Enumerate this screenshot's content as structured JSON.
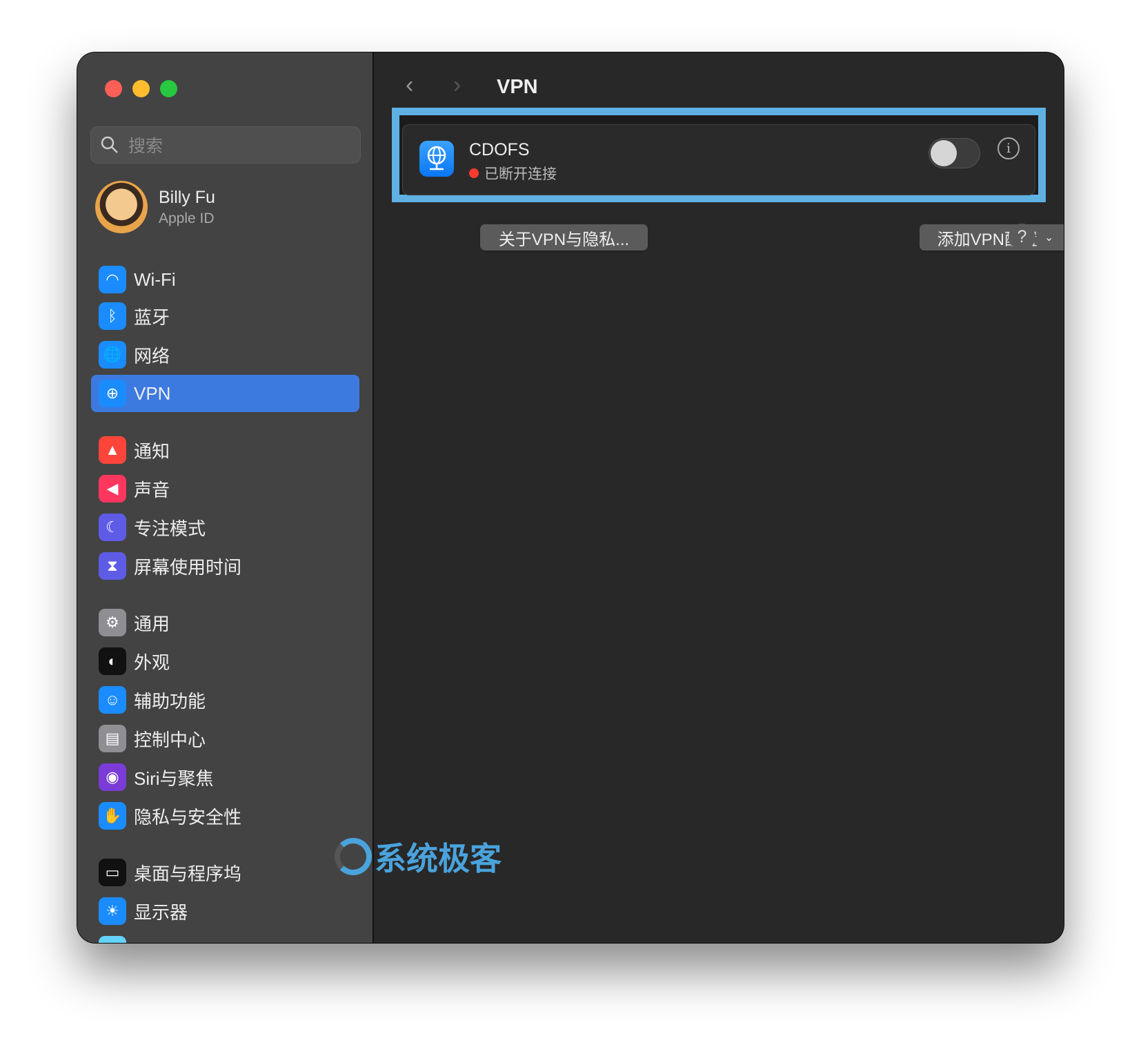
{
  "window": {
    "traffic_lights": [
      "#ff5f57",
      "#febc2e",
      "#28c840"
    ]
  },
  "sidebar": {
    "search_placeholder": "搜索",
    "user": {
      "name": "Billy Fu",
      "subtitle": "Apple ID"
    },
    "items": [
      {
        "label": "Wi-Fi",
        "icon": "wifi-icon",
        "color": "#1a8cff"
      },
      {
        "label": "蓝牙",
        "icon": "bluetooth-icon",
        "color": "#1a8cff"
      },
      {
        "label": "网络",
        "icon": "globe-icon",
        "color": "#1a8cff"
      },
      {
        "label": "VPN",
        "icon": "vpn-globe-icon",
        "color": "#1a8cff",
        "selected": true
      },
      {
        "label": "通知",
        "icon": "bell-icon",
        "color": "#ff453a"
      },
      {
        "label": "声音",
        "icon": "speaker-icon",
        "color": "#ff375f"
      },
      {
        "label": "专注模式",
        "icon": "moon-icon",
        "color": "#5e5ce6"
      },
      {
        "label": "屏幕使用时间",
        "icon": "hourglass-icon",
        "color": "#5e5ce6"
      },
      {
        "label": "通用",
        "icon": "gear-icon",
        "color": "#8e8e93"
      },
      {
        "label": "外观",
        "icon": "appearance-icon",
        "color": "#111111"
      },
      {
        "label": "辅助功能",
        "icon": "accessibility-icon",
        "color": "#1a8cff"
      },
      {
        "label": "控制中心",
        "icon": "control-center-icon",
        "color": "#8e8e93"
      },
      {
        "label": "Siri与聚焦",
        "icon": "siri-icon",
        "color": "#7a3bd6"
      },
      {
        "label": "隐私与安全性",
        "icon": "hand-icon",
        "color": "#1a8cff"
      },
      {
        "label": "桌面与程序坞",
        "icon": "dock-icon",
        "color": "#111111"
      },
      {
        "label": "显示器",
        "icon": "sun-icon",
        "color": "#1a8cff"
      }
    ]
  },
  "main": {
    "title": "VPN",
    "vpn": {
      "name": "CDOFS",
      "status": "已断开连接",
      "status_color": "#ff3b30",
      "enabled": false
    },
    "about_button": "关于VPN与隐私...",
    "add_button": "添加VPN配置",
    "help": "?",
    "info": "i"
  },
  "watermark": "系统极客",
  "accent": "#3d7ae0",
  "highlight_color": "#5fb0e3"
}
